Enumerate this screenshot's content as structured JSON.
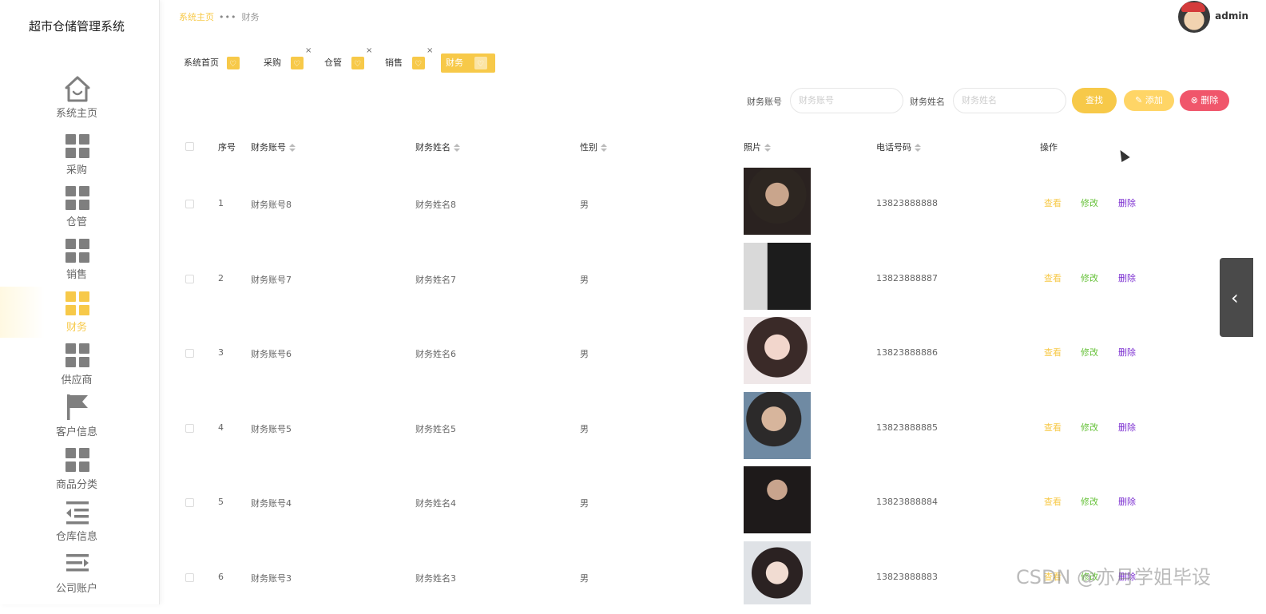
{
  "app": {
    "title": "超市仓储管理系统"
  },
  "sidebar": {
    "items": [
      {
        "label": "系统主页",
        "icon": "home-icon"
      },
      {
        "label": "采购",
        "icon": "grid-icon"
      },
      {
        "label": "仓管",
        "icon": "grid-icon"
      },
      {
        "label": "销售",
        "icon": "grid-icon"
      },
      {
        "label": "财务",
        "icon": "grid-icon",
        "active": true
      },
      {
        "label": "供应商",
        "icon": "grid-icon"
      },
      {
        "label": "客户信息",
        "icon": "flag-icon"
      },
      {
        "label": "商品分类",
        "icon": "grid-icon"
      },
      {
        "label": "仓库信息",
        "icon": "indent-icon"
      },
      {
        "label": "公司账户",
        "icon": "menu-icon"
      }
    ]
  },
  "breadcrumb": {
    "home": "系统主页",
    "current": "财务",
    "separator": "•••"
  },
  "user": {
    "name": "admin"
  },
  "tabs": [
    {
      "label": "系统首页"
    },
    {
      "label": "采购",
      "closable": true
    },
    {
      "label": "仓管",
      "closable": true
    },
    {
      "label": "销售",
      "closable": true
    },
    {
      "label": "财务",
      "closable": true,
      "active": true
    }
  ],
  "search": {
    "account_label": "财务账号",
    "account_placeholder": "财务账号",
    "name_label": "财务姓名",
    "name_placeholder": "财务姓名",
    "search_button": "查找",
    "add_button": "添加",
    "delete_button": "删除"
  },
  "table": {
    "columns": [
      "序号",
      "财务账号",
      "财务姓名",
      "性别",
      "照片",
      "电话号码",
      "操作"
    ],
    "rows": [
      {
        "index": "1",
        "account": "财务账号8",
        "name": "财务姓名8",
        "gender": "男",
        "phone": "13823888888"
      },
      {
        "index": "2",
        "account": "财务账号7",
        "name": "财务姓名7",
        "gender": "男",
        "phone": "13823888887"
      },
      {
        "index": "3",
        "account": "财务账号6",
        "name": "财务姓名6",
        "gender": "男",
        "phone": "13823888886"
      },
      {
        "index": "4",
        "account": "财务账号5",
        "name": "财务姓名5",
        "gender": "男",
        "phone": "13823888885"
      },
      {
        "index": "5",
        "account": "财务账号4",
        "name": "财务姓名4",
        "gender": "男",
        "phone": "13823888884"
      },
      {
        "index": "6",
        "account": "财务账号3",
        "name": "财务姓名3",
        "gender": "男",
        "phone": "13823888883"
      }
    ],
    "actions": {
      "view": "查看",
      "edit": "修改",
      "delete": "删除"
    }
  },
  "watermark": "CSDN @亦月学姐毕设",
  "colors": {
    "accent": "#f7c949",
    "danger": "#f0566b",
    "edit": "#67c23a",
    "delete_link": "#7c2fd1"
  }
}
